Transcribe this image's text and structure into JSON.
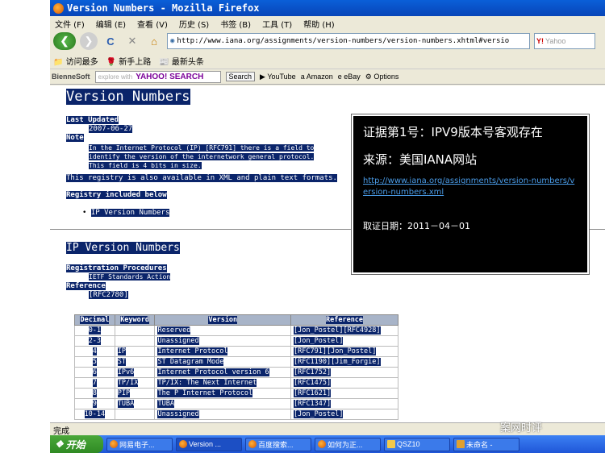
{
  "window": {
    "title": "Version Numbers - Mozilla Firefox"
  },
  "menu": [
    "文件 (F)",
    "编辑 (E)",
    "查看 (V)",
    "历史 (S)",
    "书签 (B)",
    "工具 (T)",
    "帮助 (H)"
  ],
  "nav": {
    "url": "http://www.iana.org/assignments/version-numbers/version-numbers.xhtml#versio",
    "search_placeholder": "Yahoo"
  },
  "bookmarks": [
    "访问最多",
    "新手上路",
    "最新头条"
  ],
  "toolbar2": {
    "brand": "BienneSoft",
    "search_hint": "explore with",
    "search_brand": "YAHOO! SEARCH",
    "search_button": "Search",
    "links": [
      "YouTube",
      "Amazon",
      "eBay",
      "Options"
    ]
  },
  "page": {
    "title": "Version Numbers",
    "last_updated_label": "Last Updated",
    "last_updated": "2007-06-27",
    "note_label": "Note",
    "note_text": "In the Internet Protocol (IP) [RFC791] there is a field to identify the version of the internetwork general protocol.  This field is 4 bits in size.",
    "registry_text": "This registry is also available in XML and plain text formats.",
    "registry_included": "Registry included below",
    "registry_item": "IP Version Numbers",
    "section_title": "IP Version Numbers",
    "reg_proc_label": "Registration Procedures",
    "reg_proc": "IETF Standards Action",
    "reference_label": "Reference",
    "reference": "[RFC2780]"
  },
  "table": {
    "headers": [
      "Decimal",
      "Keyword",
      "Version",
      "Reference"
    ],
    "rows": [
      [
        "0-1",
        "",
        "Reserved",
        "[Jon_Postel][RFC4928]"
      ],
      [
        "2-3",
        "",
        "Unassigned",
        "[Jon_Postel]"
      ],
      [
        "4",
        "IP",
        "Internet Protocol",
        "[RFC791][Jon_Postel]"
      ],
      [
        "5",
        "ST",
        "ST Datagram Mode",
        "[RFC1190][Jim_Forgie]"
      ],
      [
        "6",
        "IPv6",
        "Internet Protocol version 6",
        "[RFC1752]"
      ],
      [
        "7",
        "TP/IX",
        "TP/IX: The Next Internet",
        "[RFC1475]"
      ],
      [
        "8",
        "PIP",
        "The P Internet Protocol",
        "[RFC1621]"
      ],
      [
        "9",
        "TUBA",
        "TUBA",
        "[RFC1347]"
      ],
      [
        "10-14",
        "",
        "Unassigned",
        "[Jon_Postel]"
      ]
    ]
  },
  "overlay": {
    "line1": "证据第1号：IPV9版本号客观存在",
    "line2": "来源：美国IANA网站",
    "link": "http://www.iana.org/assignments/version-numbers/version-numbers.xml",
    "date": "取证日期：2011－04－01"
  },
  "status": "完成",
  "taskbar": {
    "start": "开始",
    "items": [
      "网易电子...",
      "Version ...",
      "百度搜索...",
      "如何为正...",
      "QSZ10",
      "未命名 -"
    ]
  },
  "watermark": "案网时评"
}
